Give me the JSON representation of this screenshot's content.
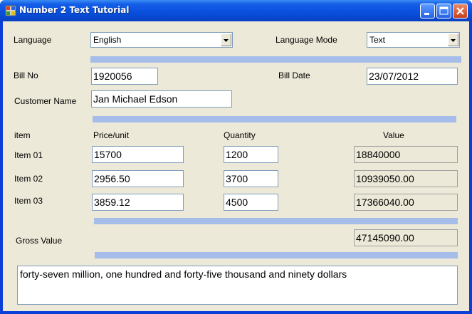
{
  "window": {
    "title": "Number 2 Text Tutorial"
  },
  "language": {
    "label": "Language",
    "value": "English"
  },
  "language_mode": {
    "label": "Language Mode",
    "value": "Text"
  },
  "bill": {
    "bill_no_label": "Bill No",
    "bill_no": "1920056",
    "bill_date_label": "Bill Date",
    "bill_date": "23/07/2012",
    "customer_label": "Customer Name",
    "customer": "Jan Michael Edson"
  },
  "grid": {
    "headers": {
      "item": "item",
      "price": "Price/unit",
      "quantity": "Quantity",
      "value": "Value"
    },
    "rows": [
      {
        "item": "Item 01",
        "price": "15700",
        "quantity": "1200",
        "value": "18840000"
      },
      {
        "item": "Item 02",
        "price": "2956.50",
        "quantity": "3700",
        "value": "10939050.00"
      },
      {
        "item": "Item 03",
        "price": "3859.12",
        "quantity": "4500",
        "value": "17366040.00"
      }
    ]
  },
  "gross": {
    "label": "Gross Value",
    "value": "47145090.00"
  },
  "words": "forty-seven million, one hundred and forty-five thousand and ninety dollars",
  "colors": {
    "separator": "#a6bde9",
    "client_bg": "#ece9d8",
    "titlebar": "#0a52e0"
  }
}
